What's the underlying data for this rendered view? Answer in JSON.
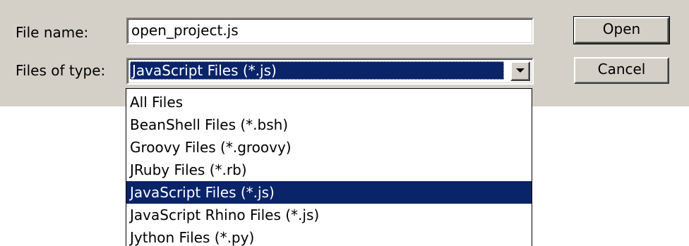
{
  "colors": {
    "dialog_background": "#d4d0c8",
    "selection_background": "#0a246a",
    "selection_text": "#ffffff"
  },
  "form": {
    "file_name_label": "File name:",
    "file_name_value": "open_project.js",
    "files_of_type_label": "Files of type:",
    "files_of_type_selected": "JavaScript Files (*.js)",
    "dropdown_arrow_icon": "chevron-down-icon"
  },
  "buttons": {
    "open_label": "Open",
    "cancel_label": "Cancel"
  },
  "file_types": {
    "selected_index": 4,
    "items": [
      {
        "label": "All Files"
      },
      {
        "label": "BeanShell Files (*.bsh)"
      },
      {
        "label": "Groovy Files (*.groovy)"
      },
      {
        "label": "JRuby Files (*.rb)"
      },
      {
        "label": "JavaScript Files (*.js)"
      },
      {
        "label": "JavaScript Rhino Files (*.js)"
      },
      {
        "label": "Jython Files (*.py)"
      }
    ]
  }
}
